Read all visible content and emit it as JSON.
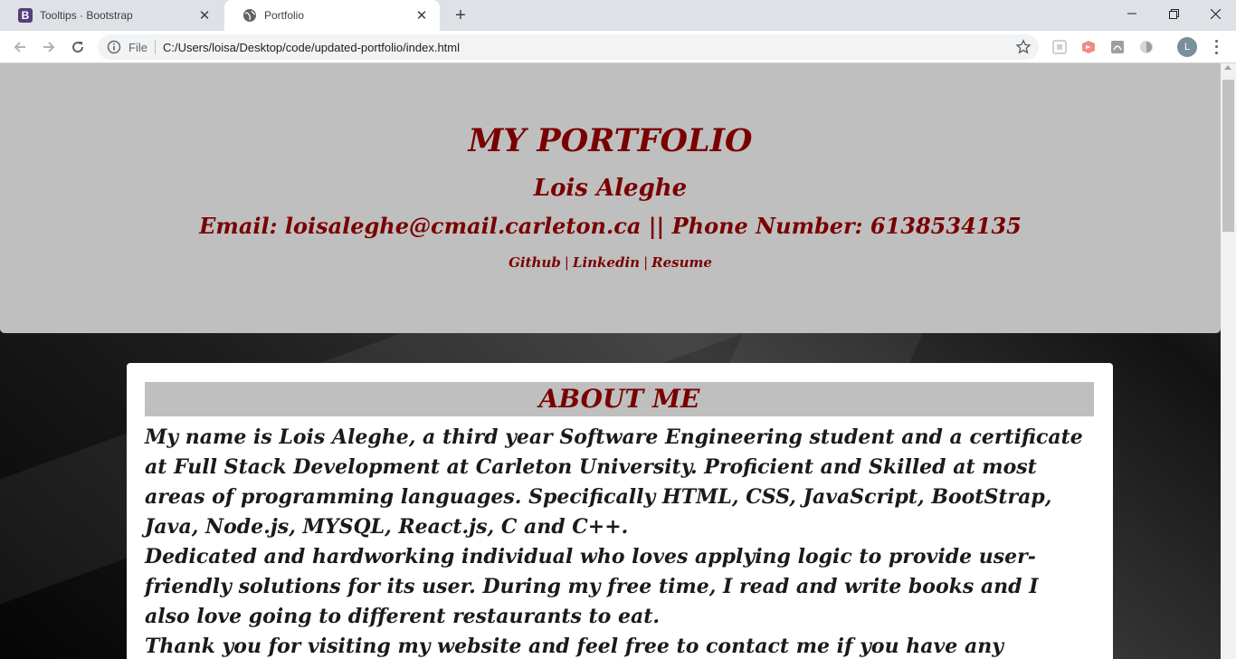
{
  "browser": {
    "tabs": [
      {
        "title": "Tooltips · Bootstrap",
        "icon": "bootstrap-icon",
        "icon_letter": "B"
      },
      {
        "title": "Portfolio",
        "icon": "globe-icon"
      }
    ],
    "scheme_label": "File",
    "url": "C:/Users/loisa/Desktop/code/updated-portfolio/index.html",
    "profile_initial": "L"
  },
  "hero": {
    "title": "MY PORTFOLIO",
    "name": "Lois Aleghe",
    "contact": "Email: loisaleghe@cmail.carleton.ca || Phone Number: 6138534135",
    "links": [
      "Github",
      "Linkedin",
      "Resume"
    ],
    "separator": "|"
  },
  "about": {
    "heading": "ABOUT ME",
    "paragraphs": [
      "My name is Lois Aleghe, a third year Software Engineering student and a certificate at Full Stack Development at Carleton University. Proficient and Skilled at most areas of programming languages. Specifically HTML, CSS, JavaScript, BootStrap, Java, Node.js, MYSQL, React.js, C and C++.",
      "Dedicated and hardworking individual who loves applying logic to provide user-friendly solutions for its user. During my free time, I read and write books and I also love going to different restaurants to eat.",
      "Thank you for visiting my website and feel free to contact me if you have any questions"
    ]
  },
  "colors": {
    "accent": "#7a0000",
    "hero_bg": "#bfbfbf",
    "card_bg": "#ffffff"
  }
}
